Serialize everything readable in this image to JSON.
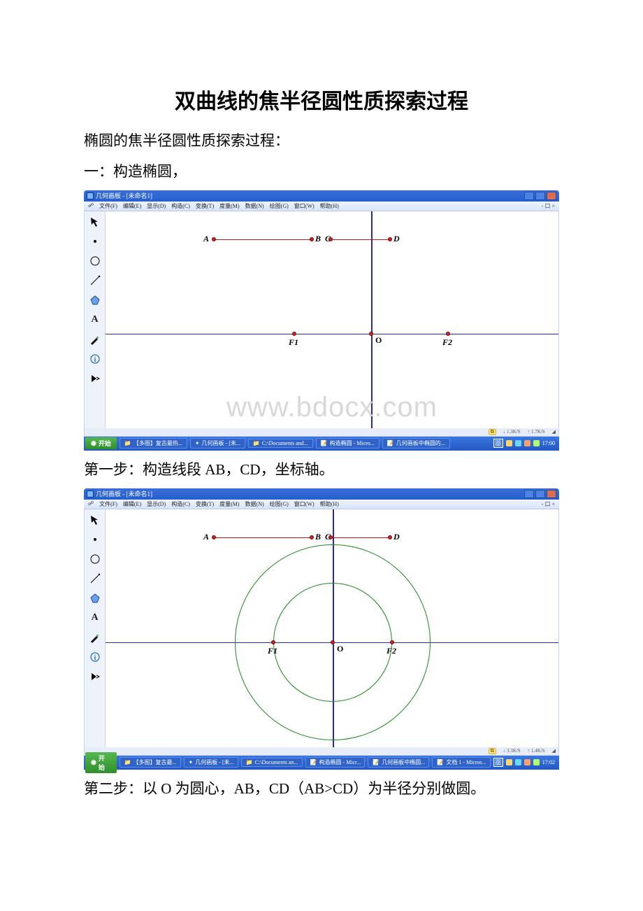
{
  "doc": {
    "title": "双曲线的焦半径圆性质探索过程",
    "intro": "椭圆的焦半径圆性质探索过程：",
    "section1": "一：构造椭圆，",
    "step1": "第一步：构造线段 AB，CD，坐标轴。",
    "step2": "第二步：以 O 为圆心，AB，CD（AB>CD）为半径分别做圆。",
    "watermark": "www.bdocx.com"
  },
  "app": {
    "title_prefix": "几何画板 - ",
    "doc_name": "[未命名1]",
    "menus": [
      "文件(F)",
      "编辑(E)",
      "显示(D)",
      "构造(C)",
      "变换(T)",
      "度量(M)",
      "数据(N)",
      "绘图(G)",
      "窗口(W)",
      "帮助(H)"
    ],
    "inner_close": "- 口 ×"
  },
  "status": {
    "s1_left": "1.3K/S",
    "s1_right": "1.7K/S",
    "s2_left": "3.3K/S",
    "s2_right": "1.4K/S"
  },
  "task": {
    "start": "开始",
    "items_s1": [
      "【多图】复古最热...",
      "几何画板 - [未...",
      "C:\\Documents and...",
      "构造椭圆 - Micro...",
      "几何画板中椭圆的..."
    ],
    "items_s2": [
      "【多图】复古最...",
      "几何画板 - [未...",
      "C:\\Documents an...",
      "构造椭圆 - Micr...",
      "几何画板中椭圆...",
      "文档 1 - Micros..."
    ],
    "time1": "17:00",
    "time2": "17:02"
  },
  "geom": {
    "A": "A",
    "B": "B",
    "C": "C",
    "D": "D",
    "O": "O",
    "F1": "F1",
    "F2": "F2"
  }
}
